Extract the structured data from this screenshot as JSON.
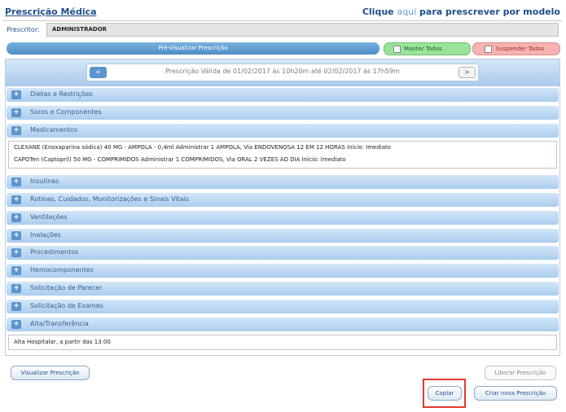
{
  "header": {
    "title": "Prescrição Médica",
    "model_link_prefix": "Clique ",
    "model_link_aqui": "aqui",
    "model_link_suffix": " para prescrever por modelo"
  },
  "prescritor": {
    "label": "Prescritor:",
    "value": "ADMINISTRADOR"
  },
  "actions_top": {
    "preview_label": "Pré-Visualizar Prescrição",
    "manter_label": "Manter Todos",
    "suspender_label": "Suspender Todos"
  },
  "validity": {
    "prev_label": "<",
    "next_label": ">",
    "text": "Prescrição Válida de 01/02/2017 às 10h20m até 02/02/2017 às 17h59m"
  },
  "sections": [
    {
      "label": "Dietas e Restrições",
      "icon": "+"
    },
    {
      "label": "Soros e Componentes",
      "icon": "+"
    },
    {
      "label": "Medicamentos",
      "icon": "+"
    },
    {
      "label": "Insulinas",
      "icon": "+"
    },
    {
      "label": "Rotinas, Cuidados, Monitorizações e Sinais Vitais",
      "icon": "+"
    },
    {
      "label": "Ventilações",
      "icon": "+"
    },
    {
      "label": "Inalações",
      "icon": "+"
    },
    {
      "label": "Procedimentos",
      "icon": "+"
    },
    {
      "label": "Hemocomponentes",
      "icon": "+"
    },
    {
      "label": "Solicitação de Parecer",
      "icon": "+"
    },
    {
      "label": "Solicitação de Exames",
      "icon": "+"
    },
    {
      "label": "Alta/Transferência",
      "icon": "+"
    }
  ],
  "medicamentos": [
    "CLEXANE (Enoxaparina sódica) 40 MG - AMPOLA - 0,4ml Administrar 1 AMPOLA, Via ENDOVENOSA 12 EM 12 HORAS Início: Imediato",
    "CAPOTen (Captopril) 50 MG - COMPRIMIDOS Administrar 1 COMPRIMIDOS, Via ORAL 2 VEZES AO DIA Início: Imediato"
  ],
  "alta": "Alta Hospitalar, a partir das 13:00",
  "buttons": {
    "visualizar": "Visualizar Prescrição",
    "liberar": "Liberar Prescrição",
    "copiar": "Copiar",
    "criar": "Criar nova Prescrição"
  },
  "colors": {
    "accent": "#1f4e8c",
    "highlight": "#e23b2f"
  }
}
